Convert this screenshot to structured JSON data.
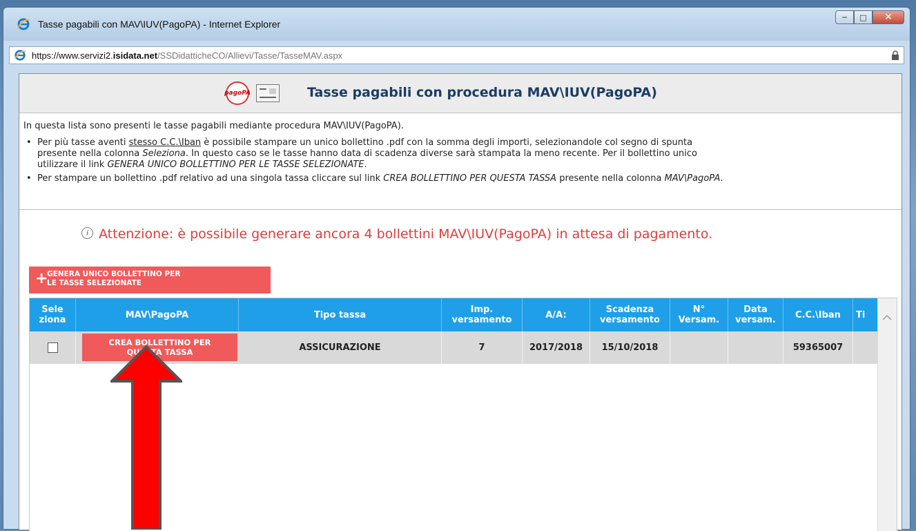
{
  "window": {
    "title": "Tasse pagabili con MAV\\IUV(PagoPA) - Internet Explorer",
    "url_prefix": "https://www.servizi2.",
    "url_domain": "isidata.net",
    "url_path": "/SSDidatticheCO/Allievi/Tasse/TasseMAV.aspx"
  },
  "header": {
    "logo_text": "pagoPA",
    "title": "Tasse pagabili con procedura MAV\\IUV(PagoPA)"
  },
  "intro": "In questa lista sono presenti le tasse pagabili mediante procedura MAV\\IUV(PagoPA).",
  "bullet1": {
    "a": "Per più tasse aventi ",
    "link": "stesso C.C.\\Iban",
    "b": " è possibile stampare un unico bollettino .pdf con la somma degli importi, selezionandole col segno di spunta",
    "c": "presente nella colonna ",
    "c_italic": "Seleziona",
    "d": ". In questo caso se le tasse hanno data di scadenza diverse sarà stampata la meno recente. Per il bollettino unico",
    "e": "utilizzare il link ",
    "e_italic": "GENERA UNICO BOLLETTINO PER LE TASSE SELEZIONATE",
    "f": "."
  },
  "bullet2": {
    "a": "Per stampare un bollettino .pdf relativo ad una singola tassa cliccare sul link ",
    "a_italic": "CREA BOLLETTINO PER QUESTA TASSA",
    "b": " presente nella colonna ",
    "b_italic": "MAV\\PagoPA",
    "c": "."
  },
  "warning": {
    "icon": "i",
    "text": "Attenzione: è possibile generare ancora 4 bollettini MAV\\IUV(PagoPA) in attesa di pagamento."
  },
  "generate_button": {
    "icon": "+",
    "label": "GENERA UNICO BOLLETTINO PER\nLE TASSE SELEZIONATE"
  },
  "table": {
    "headers": {
      "seleziona": "Sele\nziona",
      "mav": "MAV\\PagoPA",
      "tipo": "Tipo tassa",
      "imp": "Imp.\nversamento",
      "aa": "A/A:",
      "scadenza": "Scadenza\nversamento",
      "nversam": "N°\nVersam.",
      "data": "Data\nversam.",
      "cc": "C.C.\\Iban",
      "ti": "Ti"
    },
    "row": {
      "crea_label": "CREA BOLLETTINO PER\nQUESTA TASSA",
      "tipo": "ASSICURAZIONE",
      "imp": "7",
      "aa": "2017/2018",
      "scadenza": "15/10/2018",
      "nversam": "",
      "data": "",
      "cc": "59365007"
    }
  },
  "colors": {
    "accent_red": "#f05a5a",
    "header_blue": "#1e9fe8",
    "warning_red": "#e23b3b",
    "arrow_red": "#ff0000"
  }
}
